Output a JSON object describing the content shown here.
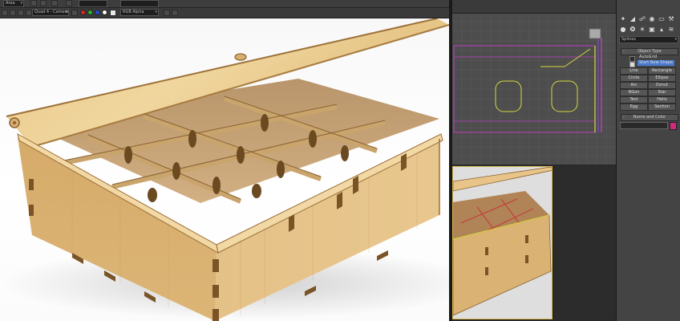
{
  "toolbar1": {
    "area_dropdown": "Area"
  },
  "toolbar2": {
    "viewport_dropdown": "Quad 4 - Camera",
    "channel_dropdown": "RGB Alpha"
  },
  "command_panel": {
    "category_dropdown": "Splines",
    "object_type": {
      "header": "Object Type",
      "autogrid_label": "AutoGrid",
      "start_new_shape_label": "Start New Shape",
      "buttons": [
        "Line",
        "Rectangle",
        "Circle",
        "Ellipse",
        "Arc",
        "Donut",
        "NGon",
        "Star",
        "Text",
        "Helix",
        "Egg",
        "Section"
      ]
    },
    "name_and_color": {
      "header": "Name and Color",
      "color": "#d02a7e"
    }
  },
  "colors": {
    "wood_light": "#eccf92",
    "wood_mid": "#dcb06c",
    "wood_edge": "#8a6230",
    "viewport_grid": "#5a5a5a",
    "active_border": "#d8b84a",
    "spline_yellow": "#d8d840",
    "spline_magenta": "#c040c0"
  }
}
